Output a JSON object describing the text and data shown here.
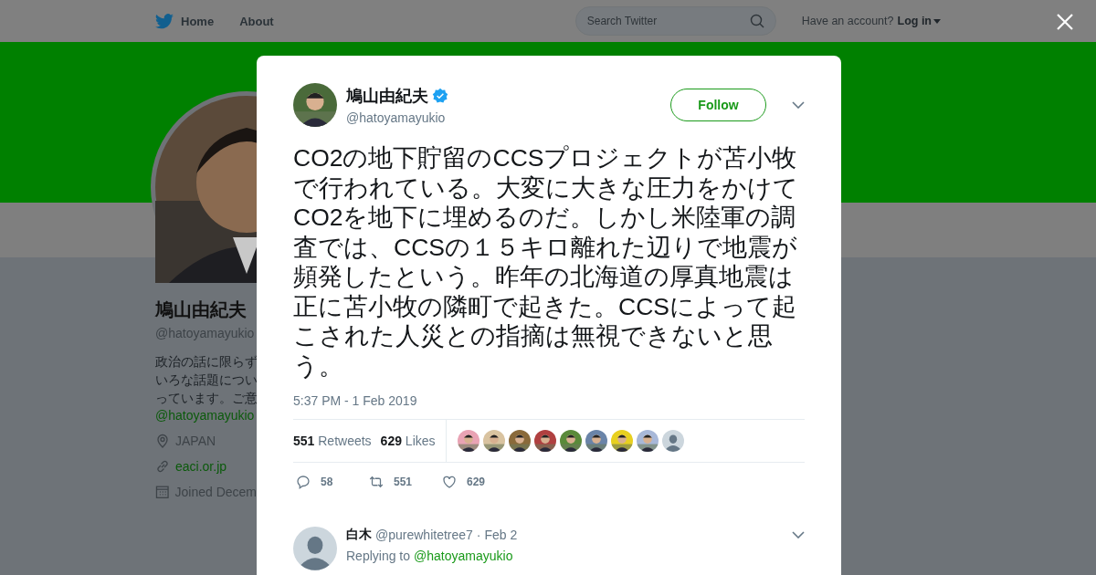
{
  "nav": {
    "home": "Home",
    "about": "About",
    "search_placeholder": "Search Twitter",
    "account_prompt": "Have an account?",
    "login": "Log in"
  },
  "profile": {
    "name": "鳩山由紀夫",
    "handle": "@hatoyamayukio",
    "bio_lines": [
      "政治の話に限らず",
      "いろな話題につい",
      "っています。ご意"
    ],
    "bio_link": "@hatoyamayukio",
    "location": "JAPAN",
    "website": "eaci.or.jp",
    "joined": "Joined Decem"
  },
  "tweet": {
    "name": "鳩山由紀夫",
    "verified": true,
    "handle": "@hatoyamayukio",
    "follow": "Follow",
    "text": "CO2の地下貯留のCCSプロジェクトが苫小牧で行われている。大変に大きな圧力をかけてCO2を地下に埋めるのだ。しかし米陸軍の調査では、CCSの１５キロ離れた辺りで地震が頻発したという。昨年の北海道の厚真地震は正に苫小牧の隣町で起きた。CCSによって起こされた人災との指摘は無視できないと思う。",
    "time": "5:37 PM - 1 Feb 2019",
    "retweets_count": "551",
    "retweets_label": "Retweets",
    "likes_count": "629",
    "likes_label": "Likes",
    "likers": [
      {
        "kind": "picture",
        "color": "#e9a3b4"
      },
      {
        "kind": "picture",
        "color": "#d9c3a0"
      },
      {
        "kind": "picture",
        "color": "#8a6a3a"
      },
      {
        "kind": "picture",
        "color": "#b04040"
      },
      {
        "kind": "picture",
        "color": "#5a8a3a"
      },
      {
        "kind": "picture",
        "color": "#6a84a8"
      },
      {
        "kind": "picture",
        "color": "#e8d020"
      },
      {
        "kind": "picture",
        "color": "#a8b8d8"
      },
      {
        "kind": "default",
        "color": "#ccd6dd"
      }
    ],
    "actions": [
      {
        "kind": "reply",
        "count": "58"
      },
      {
        "kind": "retweet",
        "count": "551"
      },
      {
        "kind": "like",
        "count": "629"
      }
    ]
  },
  "reply": {
    "name": "白木",
    "handle": "@purewhitetree7",
    "date": "· Feb 2",
    "replying_to": "Replying to",
    "mention": "@hatoyamayukio"
  }
}
